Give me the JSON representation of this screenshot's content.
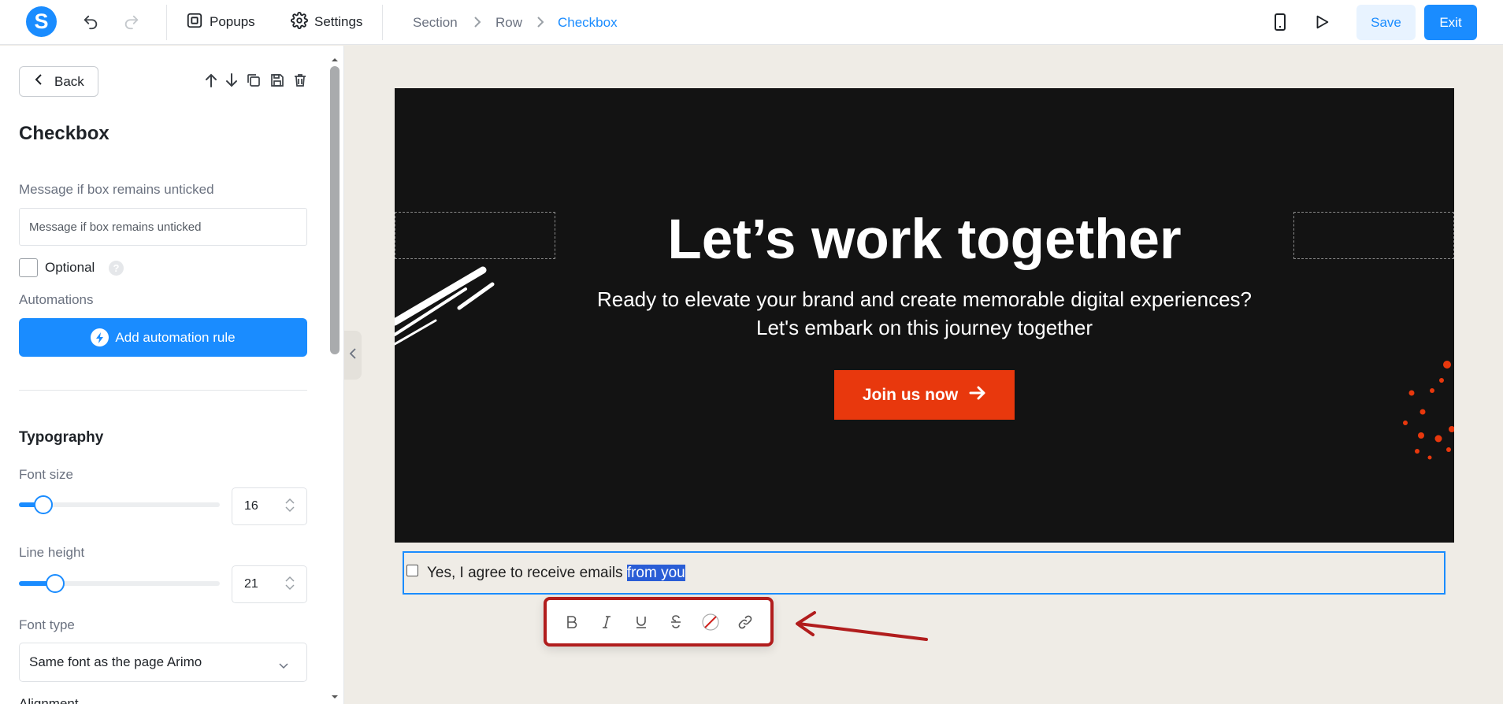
{
  "app": {
    "logo_letter": "S",
    "brand_color": "#1a8cff"
  },
  "toolbar": {
    "popups_label": "Popups",
    "settings_label": "Settings",
    "save_label": "Save",
    "exit_label": "Exit"
  },
  "breadcrumb": [
    "Section",
    "Row",
    "Checkbox"
  ],
  "sidebar": {
    "back_label": "Back",
    "title": "Checkbox",
    "message_label": "Message if box remains unticked",
    "message_placeholder": "Message if box remains unticked",
    "optional_label": "Optional",
    "automations_label": "Automations",
    "add_automation_label": "Add automation rule",
    "typography_title": "Typography",
    "font_size_label": "Font size",
    "font_size_value": "16",
    "font_size_fraction": 0.12,
    "line_height_label": "Line height",
    "line_height_value": "21",
    "line_height_fraction": 0.18,
    "font_type_label": "Font type",
    "font_type_value": "Same font as the page Arimo",
    "alignment_label": "Alignment"
  },
  "hero": {
    "title": "Let’s work together",
    "subtitle_line1": "Ready to elevate your brand and create memorable digital experiences?",
    "subtitle_line2": "Let's embark on this journey together",
    "cta_label": "Join us now",
    "accent_color": "#e8380d"
  },
  "checkbox_row": {
    "text_before": "Yes, I agree to receive emails ",
    "text_selected": "from you"
  },
  "format_toolbar": {
    "buttons": [
      "bold-icon",
      "italic-icon",
      "underline-icon",
      "strikethrough-icon",
      "clear-color-icon",
      "link-icon"
    ],
    "highlight_color": "#b11d1d"
  }
}
